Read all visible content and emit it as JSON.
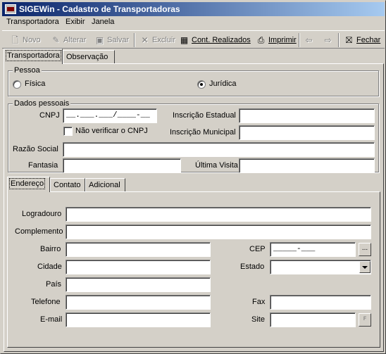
{
  "window": {
    "title": "SIGEWin - Cadastro de Transportadoras"
  },
  "menu": [
    {
      "label": "Transportadora"
    },
    {
      "label": "Exibir"
    },
    {
      "label": "Janela"
    }
  ],
  "toolbar": {
    "novo": "Novo",
    "alterar": "Alterar",
    "salvar": "Salvar",
    "excluir": "Excluir",
    "cont_realizados": "Cont. Realizados",
    "imprimir": "Imprimir",
    "fechar": "Fechar"
  },
  "tabs": {
    "transportadora": "Transportadora",
    "observacao": "Observação"
  },
  "pessoa": {
    "title": "Pessoa",
    "fisica": "Física",
    "juridica": "Jurídica",
    "selected": "juridica"
  },
  "dados": {
    "title": "Dados pessoais",
    "cnpj_label": "CNPJ",
    "cnpj_value": "__.___.___/____-__",
    "nao_verificar": "Não verificar o CNPJ",
    "inscricao_estadual": "Inscrição Estadual",
    "inscricao_municipal": "Inscrição Municipal",
    "razao_social": "Razão Social",
    "fantasia": "Fantasia",
    "ultima_visita": "Última Visita"
  },
  "subtabs": {
    "endereco": "Endereço",
    "contato": "Contato",
    "adicional": "Adicional"
  },
  "endereco": {
    "logradouro": "Logradouro",
    "complemento": "Complemento",
    "bairro": "Bairro",
    "cep": "CEP",
    "cep_value": "_____-___",
    "cep_button": "...",
    "cidade": "Cidade",
    "estado": "Estado",
    "pais": "País",
    "telefone": "Telefone",
    "fax": "Fax",
    "email": "E-mail",
    "site": "Site"
  }
}
